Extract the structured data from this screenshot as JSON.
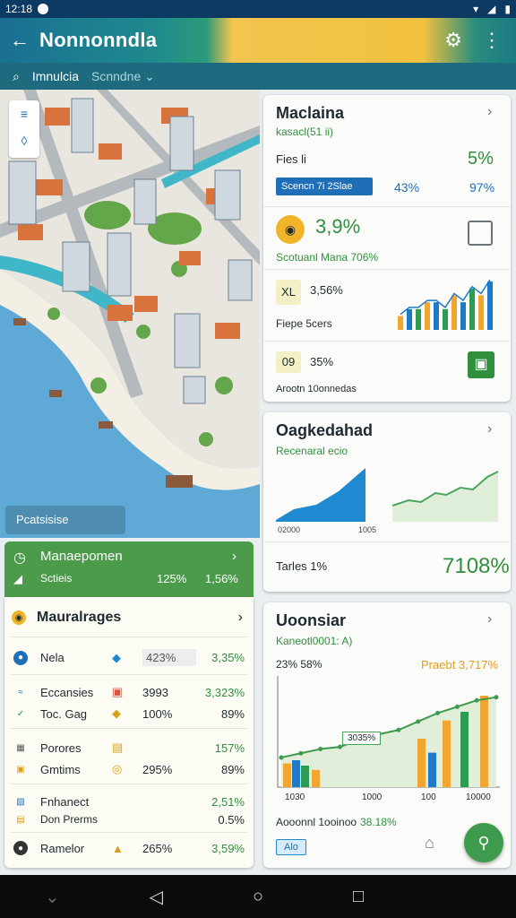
{
  "status_bar": {
    "time": "12:18"
  },
  "app_bar": {
    "title": "Nonnonndla",
    "back_icon": "arrow-left-icon",
    "settings_icon": "gear-icon",
    "menu_icon": "more-vertical-icon"
  },
  "search_bar": {
    "label": "Imnulcia",
    "secondary": "Scnndne ⌄"
  },
  "map": {
    "overlay_button": "Pcatsisise"
  },
  "card1": {
    "title": "Maclaina",
    "subtitle": "kasacl(51 ii)",
    "row1": {
      "label": "Fies  li",
      "value": "5%"
    },
    "row2": {
      "chip": "Scencn 7i 2Slae",
      "v1": "43%",
      "v2": "97%"
    },
    "row3": {
      "value": "3,9%",
      "caption": "Scotuanl Mana 706%"
    },
    "row4": {
      "tag": "XL",
      "value": "3,56%",
      "caption": "Fiepe  5cers"
    },
    "row5": {
      "tag": "09",
      "value": "35%",
      "caption": "Arootn 10onnedas"
    },
    "bars": [
      2,
      3,
      3,
      4,
      4,
      3,
      5,
      4,
      6,
      5,
      7
    ]
  },
  "card2": {
    "title": "Oagkedahad",
    "subtitle": "Recenaral ecio",
    "area_label_a": "02000",
    "area_label_b": "1005",
    "footer_label": "Tarles  1%",
    "footer_value": "7108%"
  },
  "card3": {
    "title": "Uoonsiar",
    "subtitle": "Kaneotl0001: A)",
    "left_stat": "23% 58%",
    "right_stat": "Praebt 3,717%",
    "callout": "3035%",
    "x_ticks": [
      "1030",
      "1000",
      "100",
      "10000"
    ],
    "footer_label": "Aooonnl 1ooinoo",
    "footer_value": "38.18%",
    "chip": "Alo",
    "bars": [
      {
        "c": "#f2a62f",
        "v": 0.22
      },
      {
        "c": "#1e7ac9",
        "v": 0.25
      },
      {
        "c": "#2e9b53",
        "v": 0.2
      },
      {
        "c": "#f2a62f",
        "v": 0.16
      },
      {
        "c": "#f2a62f",
        "v": 0.45
      },
      {
        "c": "#1e7ac9",
        "v": 0.32
      },
      {
        "c": "#f2a62f",
        "v": 0.62
      },
      {
        "c": "#2e9b53",
        "v": 0.7
      },
      {
        "c": "#f2a62f",
        "v": 0.85
      }
    ],
    "line": [
      0.28,
      0.32,
      0.36,
      0.38,
      0.45,
      0.5,
      0.54,
      0.62,
      0.7,
      0.76,
      0.82,
      0.85
    ]
  },
  "management": {
    "header": "Manaepomen",
    "header_sub": "Sctieis",
    "header_v1": "125%",
    "header_v2": "1,56%",
    "list_title": "Mauralrages",
    "rows": [
      {
        "name": "Nela",
        "v1": "423%",
        "v2": "3,35%"
      },
      {
        "name": "Eccansies",
        "v1": "3993",
        "v2": "3,323%"
      },
      {
        "name": "Toc. Gag",
        "v1": "100%",
        "v2": "89%"
      },
      {
        "name": "Porores",
        "v1": "",
        "v2": "157%"
      },
      {
        "name": "Gmtims",
        "v1": "295%",
        "v2": "89%"
      },
      {
        "name": "Fnhanect",
        "v1": "",
        "v2": "2,51%"
      },
      {
        "name": "Don Prerms",
        "v1": "",
        "v2": "0.5%"
      },
      {
        "name": "Ramelor",
        "v1": "265%",
        "v2": "3,59%"
      }
    ]
  },
  "colors": {
    "accent_green": "#2f8f3d",
    "accent_blue": "#1f6fb8",
    "brand_teal": "#1e6b80"
  }
}
